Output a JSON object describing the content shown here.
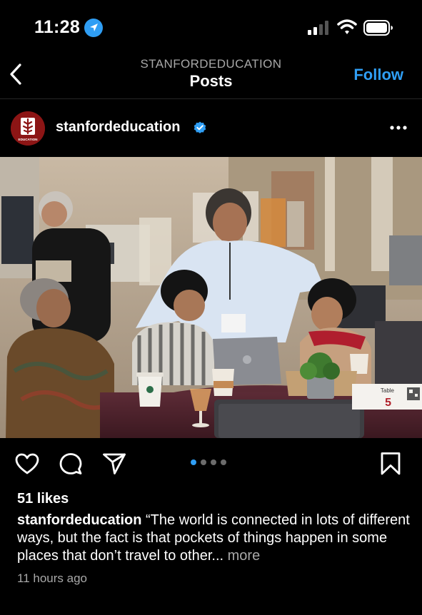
{
  "status_bar": {
    "time": "11:28",
    "icons": [
      "location-icon",
      "signal-icon",
      "wifi-icon",
      "battery-icon"
    ]
  },
  "header": {
    "back_icon": "back-icon",
    "subtitle": "STANFORDEDUCATION",
    "title": "Posts",
    "follow_label": "Follow"
  },
  "post": {
    "username": "stanfordeducation",
    "verified": true,
    "avatar_text": "EDUCATION",
    "more_icon": "more-icon",
    "image": {
      "table_label": "Table",
      "table_number": "5"
    },
    "carousel": {
      "total": 4,
      "active_index": 0
    },
    "likes": "51 likes",
    "caption": {
      "username": "stanfordeducation",
      "text": "“The world is connected in lots of different ways, but the fact is that pockets of things happen in some places that don’t travel to other...",
      "more_label": "more"
    },
    "timestamp": "11 hours ago"
  },
  "colors": {
    "background": "#000000",
    "accent_blue": "#2f9ef4",
    "secondary_text": "#a8a8a8",
    "stanford_red": "#8c1515"
  }
}
